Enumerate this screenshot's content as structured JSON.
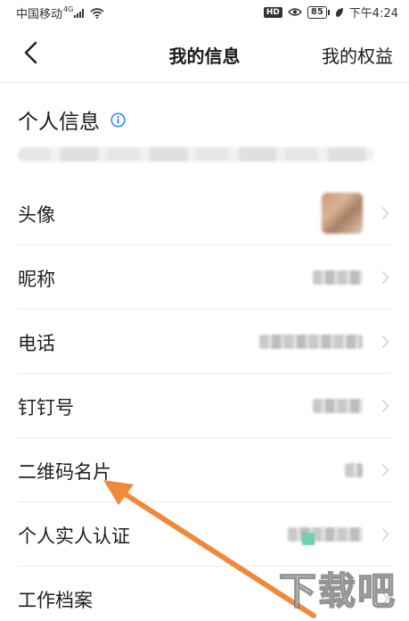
{
  "status_bar": {
    "carrier": "中国移动",
    "network": "4G",
    "hd": "HD",
    "battery": "85",
    "time": "下午4:24"
  },
  "nav": {
    "title": "我的信息",
    "right_link": "我的权益"
  },
  "section": {
    "title": "个人信息"
  },
  "rows": [
    {
      "label": "头像"
    },
    {
      "label": "昵称"
    },
    {
      "label": "电话"
    },
    {
      "label": "钉钉号"
    },
    {
      "label": "二维码名片"
    },
    {
      "label": "个人实人认证"
    },
    {
      "label": "工作档案"
    }
  ],
  "watermark": "下载吧",
  "colors": {
    "accent": "#1f86ff",
    "arrow": "#f0893a",
    "divider": "#ececec"
  }
}
